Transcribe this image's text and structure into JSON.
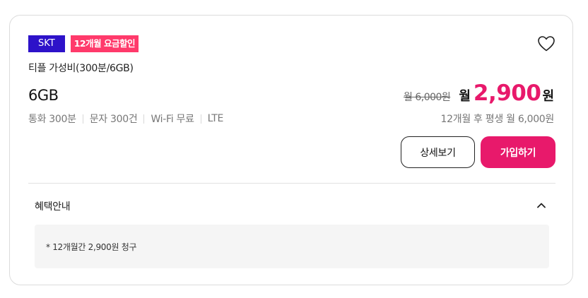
{
  "card": {
    "carrier": "SKT",
    "discount_badge": "12개월 요금할인",
    "plan_name": "티플 가성비(300분/6GB)",
    "data_amount": "6GB",
    "features": [
      "통화 300분",
      "문자 300건",
      "Wi-Fi 무료",
      "LTE"
    ],
    "original_price": "월 6,000원",
    "month_label": "월",
    "sale_price": "2,900",
    "currency": "원",
    "after_price_note": "12개월 후 평생 월 6,000원",
    "detail_button": "상세보기",
    "join_button": "가입하기",
    "benefit_title": "혜택안내",
    "benefit_text": "* 12개월간 2,900원 청구"
  },
  "colors": {
    "carrier_badge": "#2d12c9",
    "discount_badge": "#ff3a6b",
    "accent": "#e8196b"
  },
  "icons": {
    "favorite": "heart-outline-icon",
    "collapse": "chevron-up-icon"
  }
}
